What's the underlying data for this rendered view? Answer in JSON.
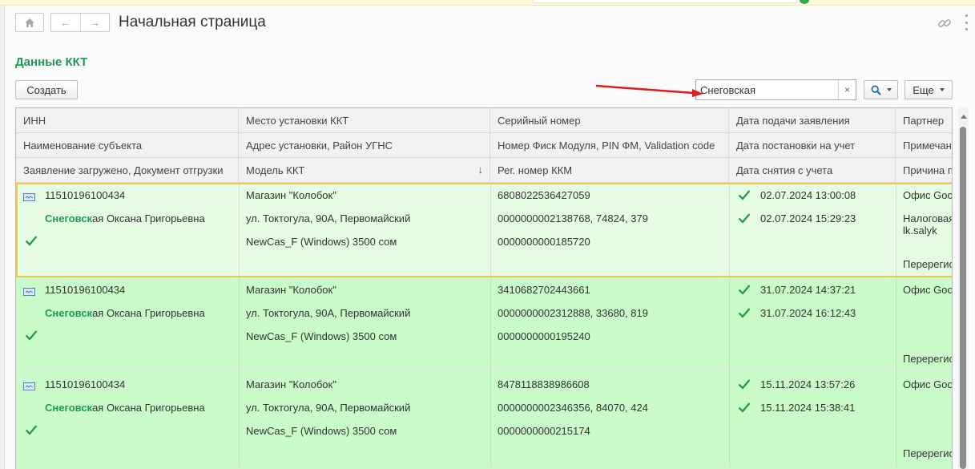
{
  "window": {
    "title": "Начальная страница"
  },
  "nav": {
    "back_glyph": "←",
    "forward_glyph": "→"
  },
  "section": {
    "title": "Данные ККТ"
  },
  "toolbar": {
    "create_label": "Создать",
    "search_value": "Снеговская",
    "clear_glyph": "×",
    "more_label": "Еще"
  },
  "columns": [
    [
      "ИНН",
      "Наименование субъекта",
      "Заявление загружено, Документ отгрузки"
    ],
    [
      "Место установки ККТ",
      "Адрес  установки, Район УГНС",
      "Модель ККТ"
    ],
    [
      "Серийный номер",
      "Номер Фиск Модуля, PIN ФМ, Validation code",
      "Рег. номер ККМ"
    ],
    [
      "Дата подачи заявления",
      "Дата постановки на учет",
      "Дата снятия с учета"
    ],
    [
      "Партнер",
      "Примечание",
      "Причина перерегистрации"
    ]
  ],
  "sort_glyph": "↓",
  "records": [
    {
      "inn": "11510196100434",
      "name_highlight": "Снеговск",
      "name_rest": "ая Оксана Григорьевна",
      "place": "Магазин \"Колобок\"",
      "address": "ул. Токтогула, 90А, Первомайский",
      "model": "NewCas_F (Windows) 3500 сом",
      "serial": "6808022536427059",
      "fiscal": "0000000002138768, 74824, 379",
      "reg": "0000000000185720",
      "date1": "02.07.2024 13:00:08",
      "date2": "02.07.2024 15:29:23",
      "partner": "Офис Goodtech",
      "note": "Налоговая",
      "note2": "lk.salyk",
      "reason": "Перерегистрация"
    },
    {
      "inn": "11510196100434",
      "name_highlight": "Снеговск",
      "name_rest": "ая Оксана Григорьевна",
      "place": "Магазин \"Колобок\"",
      "address": "ул. Токтогула, 90А, Первомайский",
      "model": "NewCas_F (Windows) 3500 сом",
      "serial": "3410682702443661",
      "fiscal": "0000000002312888, 33680, 819",
      "reg": "0000000000195240",
      "date1": "31.07.2024 14:37:21",
      "date2": "31.07.2024 16:12:43",
      "partner": "Офис Goodtech",
      "note": "",
      "note2": "",
      "reason": "Перерегистрация"
    },
    {
      "inn": "11510196100434",
      "name_highlight": "Снеговск",
      "name_rest": "ая Оксана Григорьевна",
      "place": "Магазин \"Колобок\"",
      "address": "ул. Токтогула, 90А, Первомайский",
      "model": "NewCas_F (Windows) 3500 сом",
      "serial": "8478118838986608",
      "fiscal": "0000000002346356, 84070, 424",
      "reg": "0000000000215174",
      "date1": "15.11.2024 13:57:26",
      "date2": "15.11.2024 15:38:41",
      "partner": "Офис Goodtech",
      "note": "",
      "note2": "",
      "reason": "Перерегистрация"
    }
  ],
  "colors": {
    "accent": "#1f9a52",
    "row_bg": "#c9fcc9",
    "selected_bg": "#e6fde3",
    "frame": "#f0c84a",
    "annotation": "#e01b1b"
  }
}
